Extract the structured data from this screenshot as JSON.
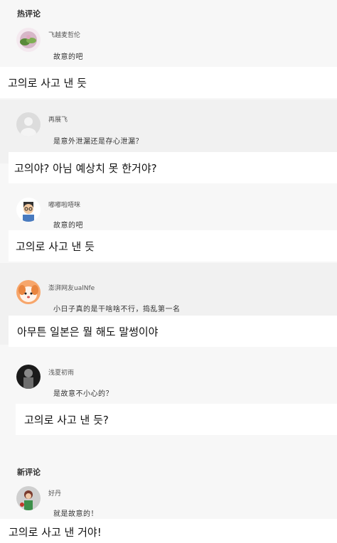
{
  "hot": {
    "title": "热评论",
    "comments": [
      {
        "username": "飞越麦哲伦",
        "text": "故意的吧",
        "translation": "고의로 사고 낸 듯"
      },
      {
        "username": "再展飞",
        "text": "是意外泄漏还是存心泄漏？",
        "translation": "고의야? 아님 예상치 못 한거야?"
      },
      {
        "username": "嘟嘟啦唔咪",
        "text": "故意的吧",
        "translation": "고의로 사고 낸 듯"
      },
      {
        "username": "澎湃网友ualNfe",
        "text": "小日子真的是干啥啥不行，捣乱第一名",
        "translation": "아무튼 일본은 뭘 해도 말썽이야"
      },
      {
        "username": "浅夏初雨",
        "text": "是故意不小心的？",
        "translation": "고의로 사고 낸 듯?"
      }
    ]
  },
  "new": {
    "title": "新评论",
    "comments": [
      {
        "username": "好丹",
        "text": "就是故意的！",
        "translation": "고의로 사고 낸 거야!"
      }
    ]
  }
}
